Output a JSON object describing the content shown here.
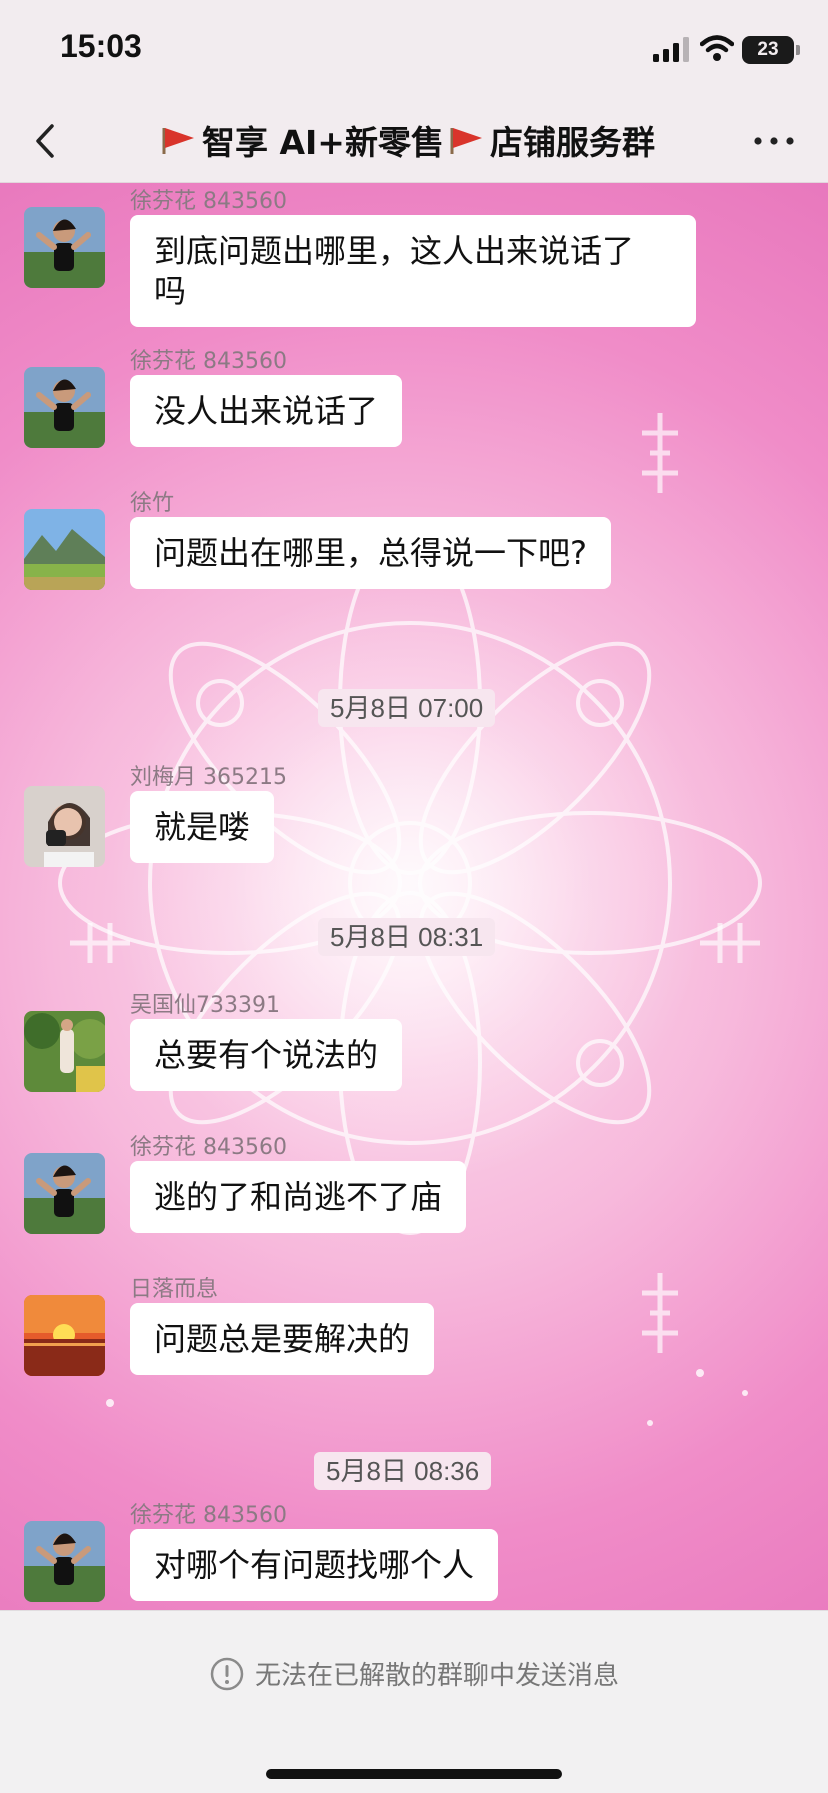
{
  "status_bar": {
    "time": "15:03",
    "battery": "23",
    "icons": [
      "signal-icon",
      "wifi-icon",
      "battery-icon"
    ]
  },
  "nav": {
    "title_parts": [
      "智享 AI+新零售",
      "店铺服务群"
    ],
    "icons": [
      "back-icon",
      "flag-icon",
      "more-icon"
    ]
  },
  "chat": {
    "m1": {
      "sender": "徐芬花 843560",
      "lines": [
        "到底问题出哪里，这人出来说话了",
        "吗"
      ]
    },
    "m2": {
      "sender": "徐芬花 843560",
      "text": "没人出来说话了"
    },
    "m3": {
      "sender": "徐竹",
      "text": "问题出在哪里，总得说一下吧?"
    },
    "t1": "5月8日 07:00",
    "m4": {
      "sender": "刘梅月 365215",
      "text": "就是喽"
    },
    "t2": "5月8日 08:31",
    "m5": {
      "sender": "吴国仙733391",
      "text": "总要有个说法的"
    },
    "m6": {
      "sender": "徐芬花 843560",
      "text": "逃的了和尚逃不了庙"
    },
    "m7": {
      "sender": "日落而息",
      "text": "问题总是要解决的"
    },
    "t3": "5月8日 08:36",
    "m8": {
      "sender": "徐芬花 843560",
      "text": "对哪个有问题找哪个人"
    }
  },
  "footer": {
    "notice": "无法在已解散的群聊中发送消息",
    "icon": "info-icon"
  },
  "colors": {
    "chat_background": "#f7b9dc",
    "bubble": "#ffffff",
    "sender_name": "#8c7a84",
    "flag": "#d9342b"
  }
}
